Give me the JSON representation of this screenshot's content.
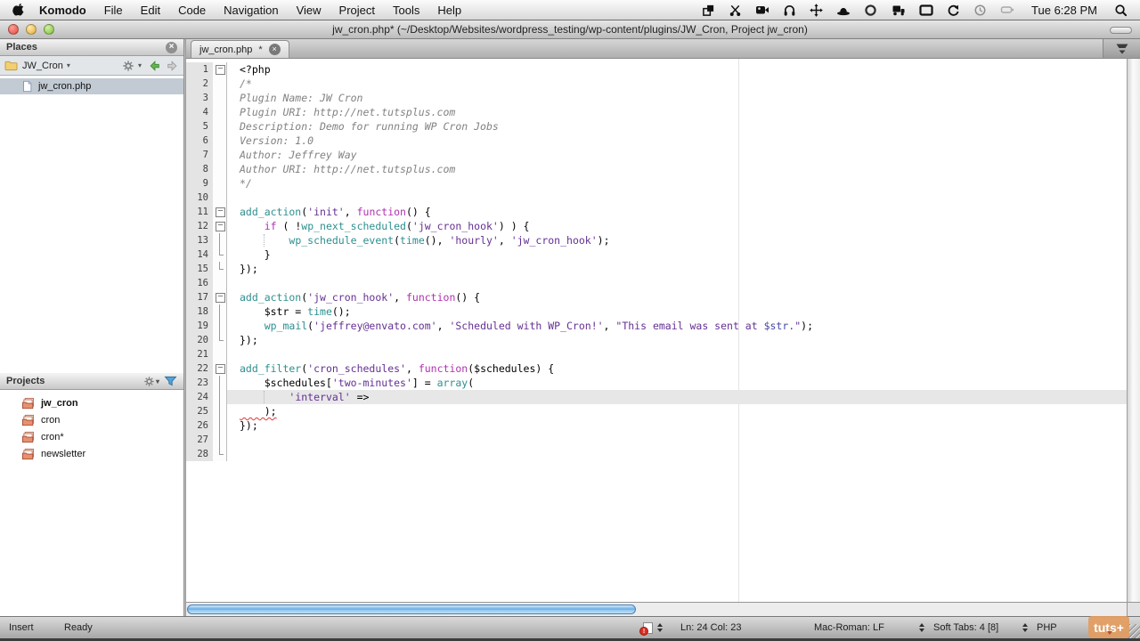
{
  "menubar": {
    "menus": [
      "Komodo",
      "File",
      "Edit",
      "Code",
      "Navigation",
      "View",
      "Project",
      "Tools",
      "Help"
    ],
    "status_icons": [
      "window-grab",
      "scissors",
      "camera",
      "headphones",
      "move",
      "hat",
      "circle",
      "truck",
      "display",
      "sync",
      "time-machine",
      "battery"
    ],
    "clock": "Tue 6:28 PM"
  },
  "window": {
    "title": "jw_cron.php* (~/Desktop/Websites/wordpress_testing/wp-content/plugins/JW_Cron, Project jw_cron)"
  },
  "places": {
    "title": "Places",
    "folder": "JW_Cron",
    "files": [
      {
        "name": "jw_cron.php",
        "selected": true
      }
    ]
  },
  "projects": {
    "title": "Projects",
    "items": [
      {
        "name": "jw_cron",
        "bold": true
      },
      {
        "name": "cron",
        "bold": false
      },
      {
        "name": "cron*",
        "bold": false
      },
      {
        "name": "newsletter",
        "bold": false
      }
    ]
  },
  "tab": {
    "label": "jw_cron.php",
    "modified": "*"
  },
  "editor": {
    "lines": [
      {
        "fold": "minus",
        "tok": [
          [
            "p",
            "<?php"
          ]
        ]
      },
      {
        "tok": [
          [
            "c",
            "/*"
          ]
        ]
      },
      {
        "tok": [
          [
            "c",
            "Plugin Name: JW Cron"
          ]
        ]
      },
      {
        "tok": [
          [
            "c",
            "Plugin URI: http://net.tutsplus.com"
          ]
        ]
      },
      {
        "tok": [
          [
            "c",
            "Description: Demo for running WP Cron Jobs"
          ]
        ]
      },
      {
        "tok": [
          [
            "c",
            "Version: 1.0"
          ]
        ]
      },
      {
        "tok": [
          [
            "c",
            "Author: Jeffrey Way"
          ]
        ]
      },
      {
        "tok": [
          [
            "c",
            "Author URI: http://net.tutsplus.com"
          ]
        ]
      },
      {
        "tok": [
          [
            "c",
            "*/"
          ]
        ]
      },
      {
        "tok": []
      },
      {
        "fold": "minus",
        "tok": [
          [
            "f",
            "add_action"
          ],
          [
            "p",
            "("
          ],
          [
            "s",
            "'init'"
          ],
          [
            "p",
            ", "
          ],
          [
            "k",
            "function"
          ],
          [
            "p",
            "() {"
          ]
        ]
      },
      {
        "fold": "minus",
        "tok": [
          [
            "p",
            "    "
          ],
          [
            "k",
            "if"
          ],
          [
            "p",
            " ( !"
          ],
          [
            "f",
            "wp_next_scheduled"
          ],
          [
            "p",
            "("
          ],
          [
            "s",
            "'jw_cron_hook'"
          ],
          [
            "p",
            ") ) {"
          ]
        ]
      },
      {
        "fold": "v",
        "tok": [
          [
            "p",
            "    "
          ],
          [
            "gd",
            "    "
          ],
          [
            "f",
            "wp_schedule_event"
          ],
          [
            "p",
            "("
          ],
          [
            "f",
            "time"
          ],
          [
            "p",
            "(), "
          ],
          [
            "s",
            "'hourly'"
          ],
          [
            "p",
            ", "
          ],
          [
            "s",
            "'jw_cron_hook'"
          ],
          [
            "p",
            ");"
          ]
        ]
      },
      {
        "fold": "end",
        "tok": [
          [
            "p",
            "    }"
          ]
        ]
      },
      {
        "fold": "end",
        "tok": [
          [
            "p",
            "});"
          ]
        ]
      },
      {
        "tok": []
      },
      {
        "fold": "minus",
        "tok": [
          [
            "f",
            "add_action"
          ],
          [
            "p",
            "("
          ],
          [
            "s",
            "'jw_cron_hook'"
          ],
          [
            "p",
            ", "
          ],
          [
            "k",
            "function"
          ],
          [
            "p",
            "() {"
          ]
        ]
      },
      {
        "fold": "v",
        "tok": [
          [
            "p",
            "    $str = "
          ],
          [
            "f",
            "time"
          ],
          [
            "p",
            "();"
          ]
        ]
      },
      {
        "fold": "v",
        "tok": [
          [
            "p",
            "    "
          ],
          [
            "f",
            "wp_mail"
          ],
          [
            "p",
            "("
          ],
          [
            "s",
            "'jeffrey@envato.com'"
          ],
          [
            "p",
            ", "
          ],
          [
            "s",
            "'Scheduled with WP_Cron!'"
          ],
          [
            "p",
            ", "
          ],
          [
            "s",
            "\"This email was sent at "
          ],
          [
            "i",
            "$str."
          ],
          [
            "s",
            "\""
          ],
          [
            "p",
            ");"
          ]
        ]
      },
      {
        "fold": "end",
        "tok": [
          [
            "p",
            "});"
          ]
        ]
      },
      {
        "tok": []
      },
      {
        "fold": "minus",
        "tok": [
          [
            "f",
            "add_filter"
          ],
          [
            "p",
            "("
          ],
          [
            "s",
            "'cron_schedules'"
          ],
          [
            "p",
            ", "
          ],
          [
            "k",
            "function"
          ],
          [
            "p",
            "($schedules) {"
          ]
        ]
      },
      {
        "fold": "v",
        "tok": [
          [
            "p",
            "    $schedules["
          ],
          [
            "s",
            "'two-minutes'"
          ],
          [
            "p",
            "] = "
          ],
          [
            "f",
            "array"
          ],
          [
            "p",
            "("
          ]
        ]
      },
      {
        "fold": "v",
        "cur": true,
        "tok": [
          [
            "p",
            "    "
          ],
          [
            "gd",
            "    "
          ],
          [
            "s",
            "'interval'"
          ],
          [
            "p",
            " =>"
          ]
        ]
      },
      {
        "fold": "v",
        "tok": [
          [
            "e",
            "    );"
          ]
        ]
      },
      {
        "fold": "v",
        "tok": [
          [
            "p",
            "});"
          ]
        ]
      },
      {
        "fold": "v",
        "tok": []
      },
      {
        "fold": "end",
        "tok": []
      }
    ]
  },
  "statusbar": {
    "mode": "Insert",
    "status": "Ready",
    "position": "Ln: 24 Col: 23",
    "encoding": "Mac-Roman: LF",
    "tabs": "Soft Tabs: 4 [8]",
    "language": "PHP"
  },
  "watermark": {
    "label": "tuts+"
  },
  "colors": {
    "function": "#2e8f8f",
    "keyword": "#b030b0",
    "string": "#643093",
    "comment": "#828282",
    "current_line": "#e7e7e7",
    "selection_row": "#c2cad3",
    "scrollbar_thumb": "#64a9e1",
    "error_squiggle": "#e03838",
    "watermark_bg": "#e29c60"
  }
}
